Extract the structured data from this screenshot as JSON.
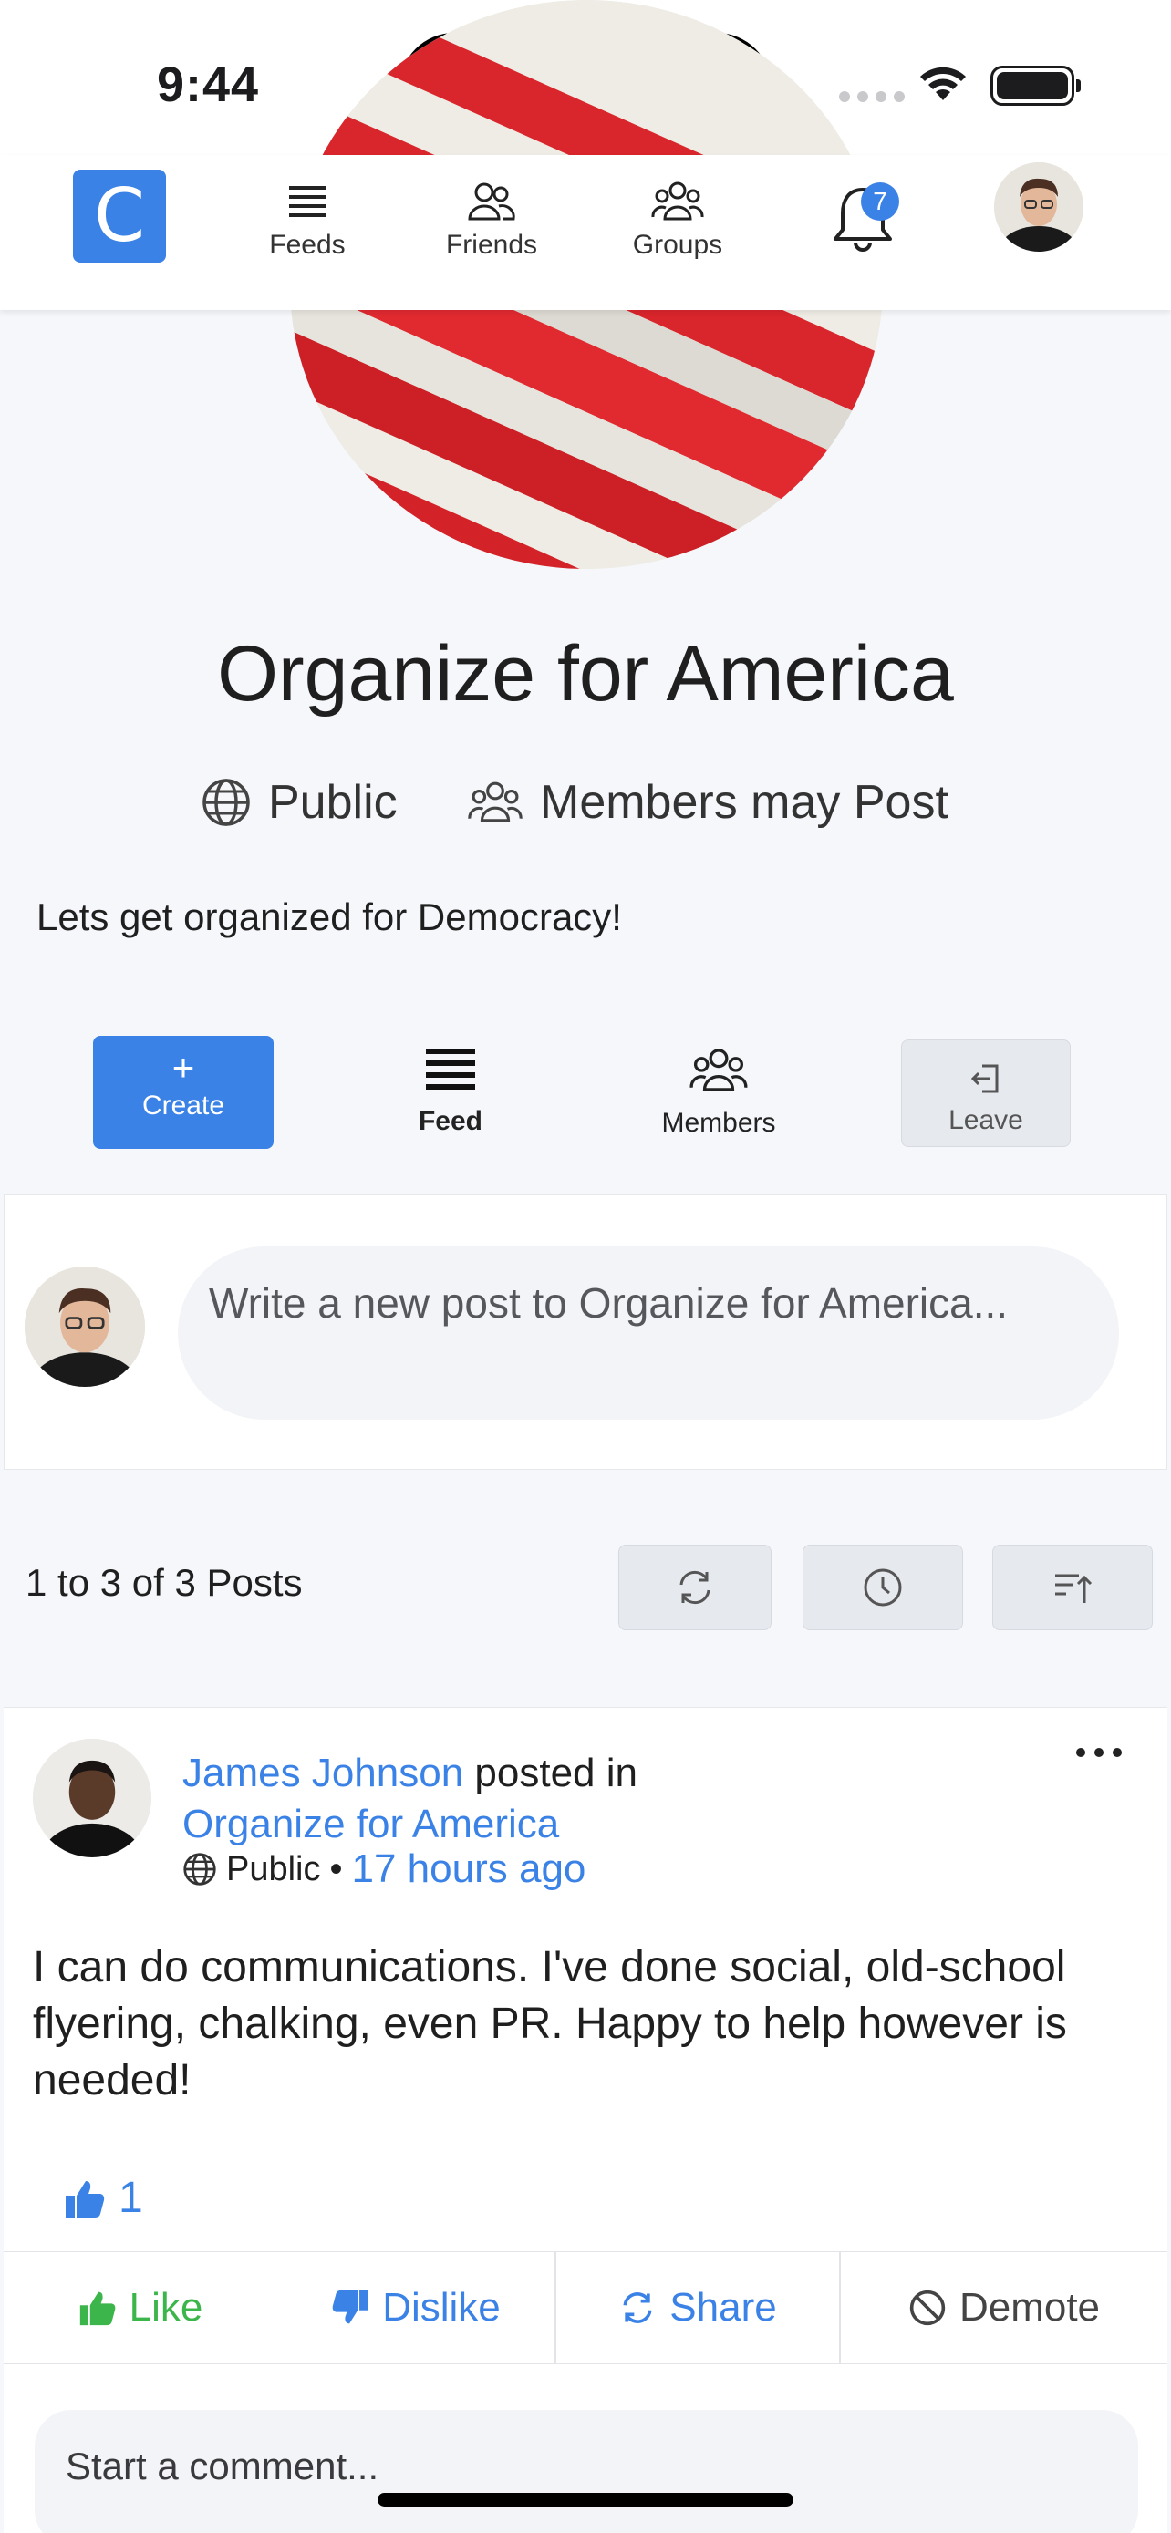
{
  "status_bar": {
    "time": "9:44"
  },
  "nav": {
    "logo_letter": "C",
    "items": [
      {
        "label": "Feeds"
      },
      {
        "label": "Friends"
      },
      {
        "label": "Groups"
      }
    ],
    "notification_count": "7"
  },
  "group": {
    "title": "Organize for America",
    "visibility": "Public",
    "posting_policy": "Members may Post",
    "description": "Lets get organized for Democracy!"
  },
  "group_tabs": {
    "create": "Create",
    "feed": "Feed",
    "members": "Members",
    "leave": "Leave"
  },
  "composer": {
    "placeholder": "Write a new post to Organize for America..."
  },
  "posts_meta": {
    "count_text": "1 to 3 of 3 Posts"
  },
  "post": {
    "author": "James Johnson",
    "posted_in_text": "posted in",
    "group_link": "Organize for America",
    "visibility": "Public",
    "separator": "•",
    "time": "17 hours ago",
    "body": "I can do communications. I've done social, old-school flyering, chalking, even PR. Happy to help however is needed!",
    "like_count": "1",
    "actions": {
      "like": "Like",
      "dislike": "Dislike",
      "share": "Share",
      "demote": "Demote"
    },
    "comment_placeholder": "Start a comment..."
  },
  "colors": {
    "accent": "#3b82e6",
    "like_green": "#3cb54a",
    "background": "#f5f7fb"
  }
}
